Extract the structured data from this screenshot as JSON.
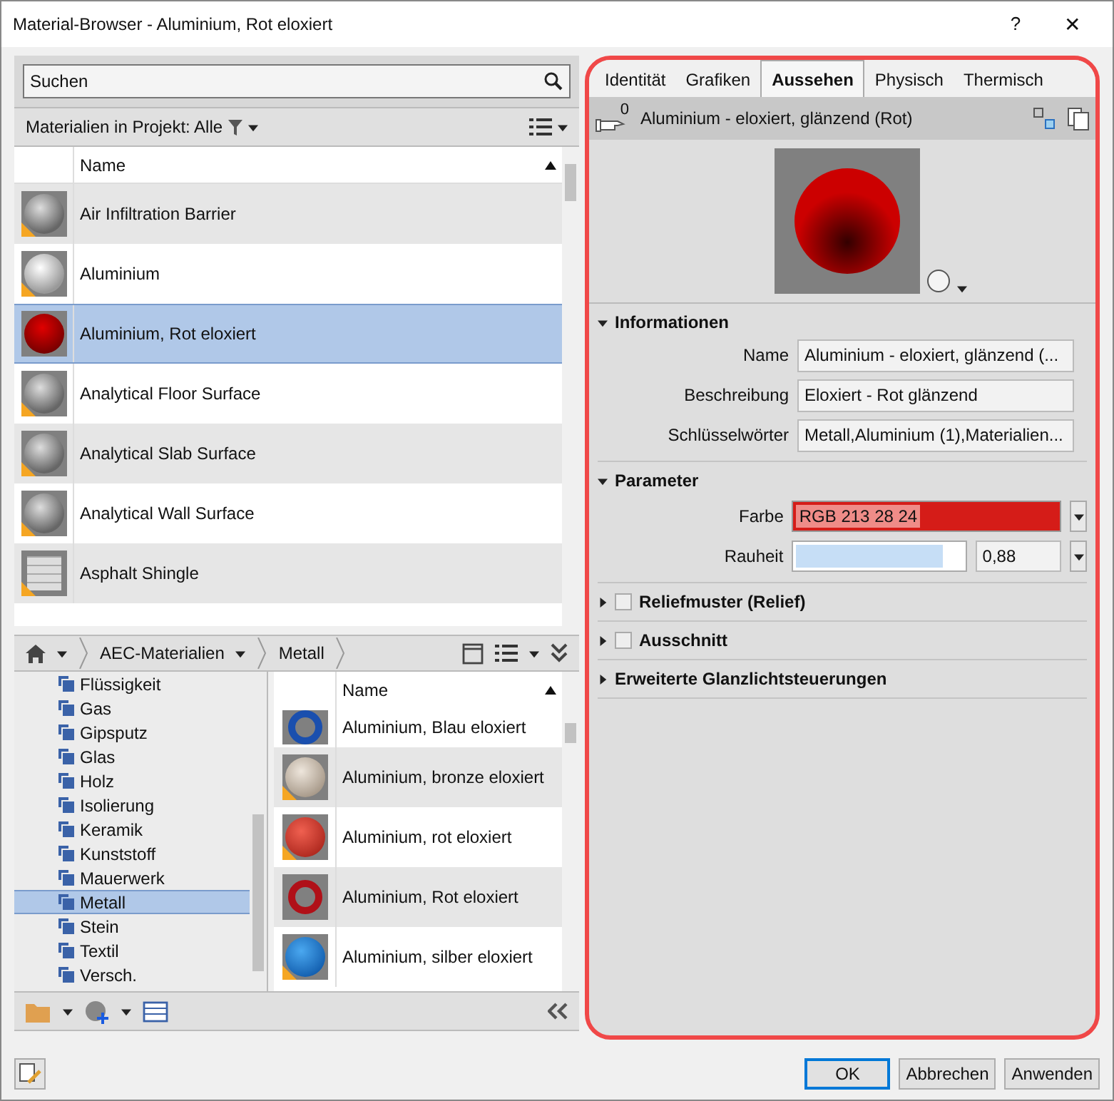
{
  "window": {
    "title": "Material-Browser - Aluminium, Rot eloxiert",
    "help": "?",
    "close": "✕"
  },
  "search": {
    "placeholder": "Suchen"
  },
  "filter": {
    "label": "Materialien in Projekt: Alle"
  },
  "project_list": {
    "columns": [
      "Name"
    ],
    "rows": [
      {
        "name": "Air Infiltration Barrier",
        "kind": "gray",
        "warning": true,
        "selected": false
      },
      {
        "name": "Aluminium",
        "kind": "silver",
        "warning": true,
        "selected": false
      },
      {
        "name": "Aluminium, Rot eloxiert",
        "kind": "red",
        "warning": false,
        "selected": true
      },
      {
        "name": "Analytical Floor Surface",
        "kind": "gray",
        "warning": true,
        "selected": false
      },
      {
        "name": "Analytical Slab Surface",
        "kind": "gray",
        "warning": true,
        "selected": false
      },
      {
        "name": "Analytical Wall Surface",
        "kind": "gray",
        "warning": true,
        "selected": false
      },
      {
        "name": "Asphalt Shingle",
        "kind": "brick",
        "warning": true,
        "selected": false
      }
    ]
  },
  "breadcrumb": [
    "AEC-Materialien",
    "Metall"
  ],
  "tree": [
    {
      "label": "Flüssigkeit",
      "selected": false
    },
    {
      "label": "Gas",
      "selected": false
    },
    {
      "label": "Gipsputz",
      "selected": false
    },
    {
      "label": "Glas",
      "selected": false
    },
    {
      "label": "Holz",
      "selected": false
    },
    {
      "label": "Isolierung",
      "selected": false
    },
    {
      "label": "Keramik",
      "selected": false
    },
    {
      "label": "Kunststoff",
      "selected": false
    },
    {
      "label": "Mauerwerk",
      "selected": false
    },
    {
      "label": "Metall",
      "selected": true
    },
    {
      "label": "Stein",
      "selected": false
    },
    {
      "label": "Textil",
      "selected": false
    },
    {
      "label": "Versch.",
      "selected": false
    }
  ],
  "library_list": {
    "columns": [
      "Name"
    ],
    "rows": [
      {
        "name": "Aluminium, Blau eloxiert",
        "kind": "ring-blue",
        "warning": false
      },
      {
        "name": "Aluminium, bronze eloxiert",
        "kind": "beige",
        "warning": true
      },
      {
        "name": "Aluminium, rot eloxiert",
        "kind": "coral",
        "warning": true
      },
      {
        "name": "Aluminium, Rot eloxiert",
        "kind": "ring-red",
        "warning": false
      },
      {
        "name": "Aluminium, silber eloxiert",
        "kind": "blue",
        "warning": true
      }
    ]
  },
  "tabs": [
    {
      "label": "Identität",
      "selected": false
    },
    {
      "label": "Grafiken",
      "selected": false
    },
    {
      "label": "Aussehen",
      "selected": true
    },
    {
      "label": "Physisch",
      "selected": false
    },
    {
      "label": "Thermisch",
      "selected": false
    }
  ],
  "asset": {
    "count": "0",
    "title": "Aluminium - eloxiert, glänzend (Rot)"
  },
  "sections": [
    {
      "title": "Informationen",
      "expanded": true,
      "kind": "fields",
      "fields": [
        {
          "label": "Name",
          "value": "Aluminium - eloxiert, glänzend (..."
        },
        {
          "label": "Beschreibung",
          "value": "Eloxiert - Rot glänzend"
        },
        {
          "label": "Schlüsselwörter",
          "value": "Metall,Aluminium (1),Materialien..."
        }
      ]
    },
    {
      "title": "Parameter",
      "expanded": true,
      "kind": "params",
      "color": {
        "label": "Farbe",
        "value": "RGB 213 28 24",
        "color": "#d51c18"
      },
      "slider": {
        "label": "Rauheit",
        "level": 0.88,
        "value": "0,88"
      }
    },
    {
      "title": "Reliefmuster (Relief)",
      "expanded": false,
      "kind": "check",
      "checked": false
    },
    {
      "title": "Ausschnitt",
      "expanded": false,
      "kind": "check",
      "checked": false
    },
    {
      "title": "Erweiterte Glanzlichtsteuerungen",
      "expanded": false,
      "kind": "plain"
    }
  ],
  "buttons": [
    {
      "label": "OK",
      "default": true
    },
    {
      "label": "Abbrechen",
      "default": false
    },
    {
      "label": "Anwenden",
      "default": false
    }
  ]
}
